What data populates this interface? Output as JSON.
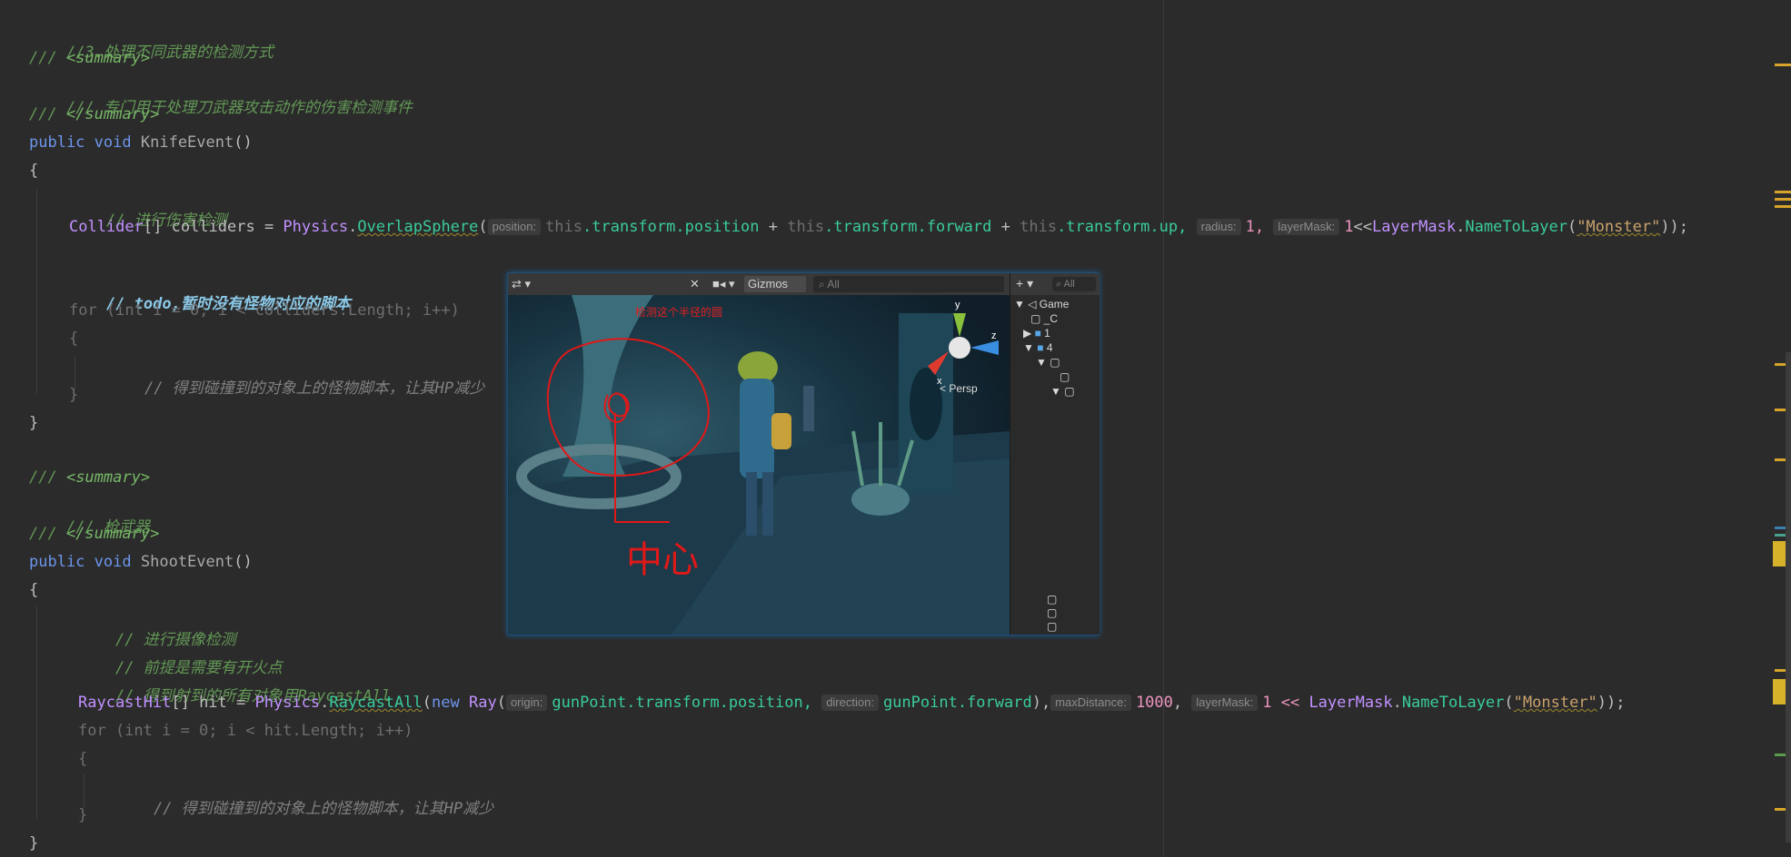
{
  "code_lines": [
    {
      "y": 22,
      "html_key": "l1"
    },
    {
      "y": 52,
      "html_key": "l2"
    }
  ],
  "comments": {
    "c1": "//3.处理不同武器的检测方式",
    "c2_open": "/// ",
    "c2_tag": "<summary>",
    "c3": "/// 专门用于处理刀武器攻击动作的伤害检测事件",
    "c4_close": "</summary>",
    "c5": "// 进行伤害检测",
    "c6": "// todo,暂时没有怪物对应的脚本",
    "c7": "// 得到碰撞到的对象上的怪物脚本，让其HP减少",
    "c8": "/// 枪武器",
    "c9": "// 进行摄像检测",
    "c10": "// 前提是需要有开火点",
    "c11": "// 得到射到的所有对象用RaycastAll",
    "c12": "// 得到碰撞到的对象上的怪物脚本，让其HP减少"
  },
  "code": {
    "public": "public",
    "void": "void",
    "knife_event": "KnifeEvent",
    "shoot_event": "ShootEvent",
    "paren": "()",
    "open_brace": "{",
    "close_brace": "}",
    "collider_arr": "Collider",
    "colliders": "[] colliders = ",
    "physics": "Physics",
    "overlap_sphere": "OverlapSphere",
    "hint_position": "position:",
    "this": "this",
    "transform_position": ".transform.position",
    "plus": " + ",
    "transform_forward": ".transform.forward",
    "transform_up": ".transform.up,",
    "hint_radius": "radius:",
    "one_comma": "1,",
    "hint_layermask": "layerMask:",
    "one": "1",
    "shift": "<<",
    "layermask": "LayerMask",
    "name_to_layer": "NameToLayer",
    "monster": "\"Monster\"",
    "end1": "));",
    "for1": "for (int i = 0; i < colliders.Length; i++)",
    "raycast_hit": "RaycastHit",
    "hit_decl": "[] hit = ",
    "raycast_all": "RaycastAll",
    "new": "new",
    "ray": "Ray",
    "hint_origin": "origin:",
    "gun_pos": "gunPoint.transform.position,",
    "hint_direction": "direction:",
    "gun_forward": "gunPoint.forward",
    "close_paren_comma": "),",
    "hint_maxdistance": "maxDistance:",
    "thousand": "1000",
    "comma": ",",
    "one_shift": "1 << ",
    "for2": "for (int i = 0; i < hit.Length; i++)"
  },
  "unity": {
    "gizmos_label": "Gizmos",
    "search_placeholder": "All",
    "hier_search": "All",
    "persp_label": "< Persp",
    "annotation": "检测这个半径的圆",
    "handwriting": "中心",
    "axis_x": "x",
    "axis_y": "y",
    "axis_z": "z",
    "hier_items": [
      "Game",
      "_C",
      "1",
      "4"
    ]
  }
}
